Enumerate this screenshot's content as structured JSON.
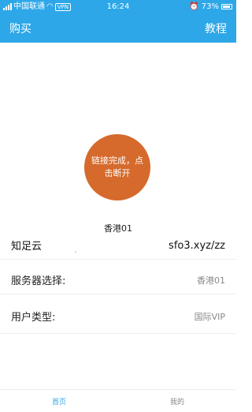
{
  "status_bar": {
    "carrier": "中国联通",
    "vpn": "VPN",
    "time": "16:24",
    "battery": "73%"
  },
  "header": {
    "left": "购买",
    "right": "教程",
    "color": "#2ea7e8"
  },
  "connect": {
    "button_label": "链接完成，点击断开",
    "color": "#d56a2c",
    "server_name": "香港01"
  },
  "brand": {
    "name": "知足云",
    "site": "sfo3.xyz/zz"
  },
  "settings": {
    "server_label": "服务器选择:",
    "server_value": "香港01",
    "user_type_label": "用户类型:",
    "user_type_value": "国际VIP"
  },
  "tabs": {
    "home": "首页",
    "me": "我的"
  }
}
